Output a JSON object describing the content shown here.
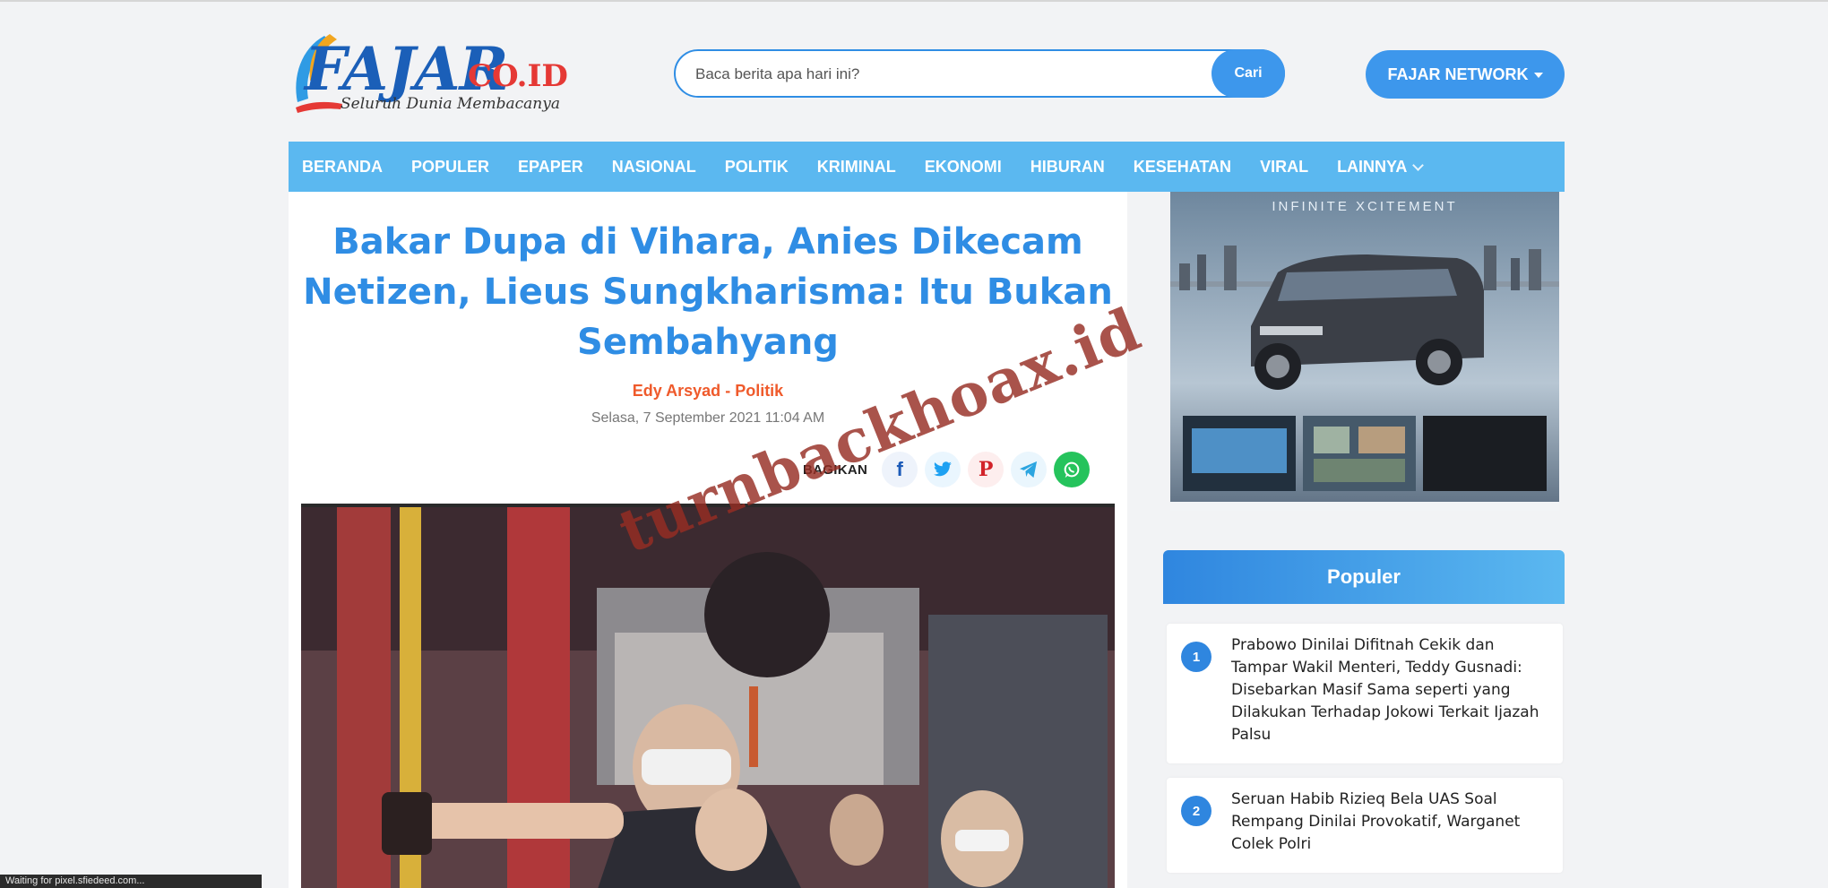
{
  "header": {
    "logo_text": "FAJAR",
    "logo_tld": "CO.ID",
    "logo_tagline": "Seluruh Dunia Membacanya",
    "search_placeholder": "Baca berita apa hari ini?",
    "search_button": "Cari",
    "network_button": "FAJAR NETWORK"
  },
  "nav": {
    "items": [
      "BERANDA",
      "POPULER",
      "EPAPER",
      "NASIONAL",
      "POLITIK",
      "KRIMINAL",
      "EKONOMI",
      "HIBURAN",
      "KESEHATAN",
      "VIRAL",
      "LAINNYA"
    ]
  },
  "article": {
    "title": "Bakar Dupa di Vihara, Anies Dikecam Netizen, Lieus Sungkharisma: Itu Bukan Sembahyang",
    "author": "Edy Arsyad",
    "separator": " - ",
    "category": "Politik",
    "date": "Selasa, 7 September 2021 11:04 AM",
    "share_label": "BAGIKAN",
    "share_icons": [
      "facebook-icon",
      "twitter-icon",
      "pinterest-icon",
      "telegram-icon",
      "whatsapp-icon"
    ]
  },
  "sidebar": {
    "ad_tagline": "INFINITE XCITEMENT",
    "popular_title": "Populer",
    "popular": [
      {
        "rank": "1",
        "title": "Prabowo Dinilai Difitnah Cekik dan Tampar Wakil Menteri, Teddy Gusnadi: Disebarkan Masif Sama seperti yang Dilakukan Terhadap Jokowi Terkait Ijazah Palsu"
      },
      {
        "rank": "2",
        "title": "Seruan Habib Rizieq Bela UAS Soal Rempang Dinilai Provokatif, Warganet Colek Polri"
      }
    ]
  },
  "watermark": "turnbackhoax.id",
  "status_bar": "Waiting for pixel.sfiedeed.com...",
  "colors": {
    "brand_blue": "#2f8de4",
    "nav_blue": "#5bb8f0",
    "accent_orange": "#ef5a2b",
    "whatsapp_green": "#25c35c"
  }
}
